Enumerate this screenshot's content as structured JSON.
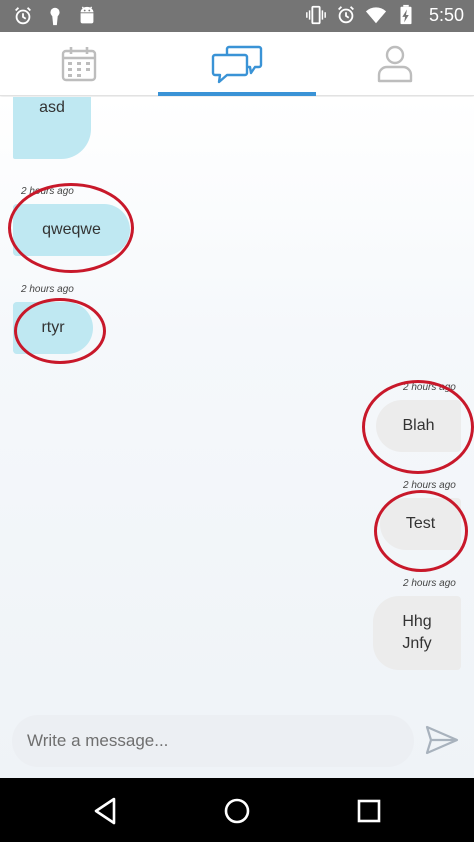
{
  "status_bar": {
    "time": "5:50",
    "left_icons": [
      "alarm-icon",
      "keyhole-icon",
      "android-icon"
    ],
    "right_icons": [
      "vibrate-icon",
      "alarm-icon",
      "wifi-icon",
      "battery-charging-icon"
    ]
  },
  "tabs": [
    {
      "icon": "calendar-icon",
      "active": false
    },
    {
      "icon": "chat-icon",
      "active": true
    },
    {
      "icon": "profile-icon",
      "active": false
    }
  ],
  "messages": [
    {
      "direction": "incoming",
      "text": "asd",
      "timestamp": ""
    },
    {
      "direction": "incoming",
      "text": "qweqwe",
      "timestamp": "2 hours ago"
    },
    {
      "direction": "incoming",
      "text": "rtyr",
      "timestamp": "2 hours ago"
    },
    {
      "direction": "outgoing",
      "text": "Blah",
      "timestamp": "2 hours ago"
    },
    {
      "direction": "outgoing",
      "text": "Test",
      "timestamp": "2 hours ago"
    },
    {
      "direction": "outgoing",
      "text": "Hhg\nJnfy",
      "timestamp": "2 hours ago"
    }
  ],
  "composer": {
    "placeholder": "Write a message...",
    "send_icon": "send-icon"
  },
  "nav": [
    "back-icon",
    "home-icon",
    "recents-icon"
  ],
  "colors": {
    "accent": "#3a93d6",
    "incoming_bubble": "#bfe8f2",
    "outgoing_bubble": "#ececec",
    "annotation_ring": "#c8182a",
    "status_bar": "#757575"
  }
}
